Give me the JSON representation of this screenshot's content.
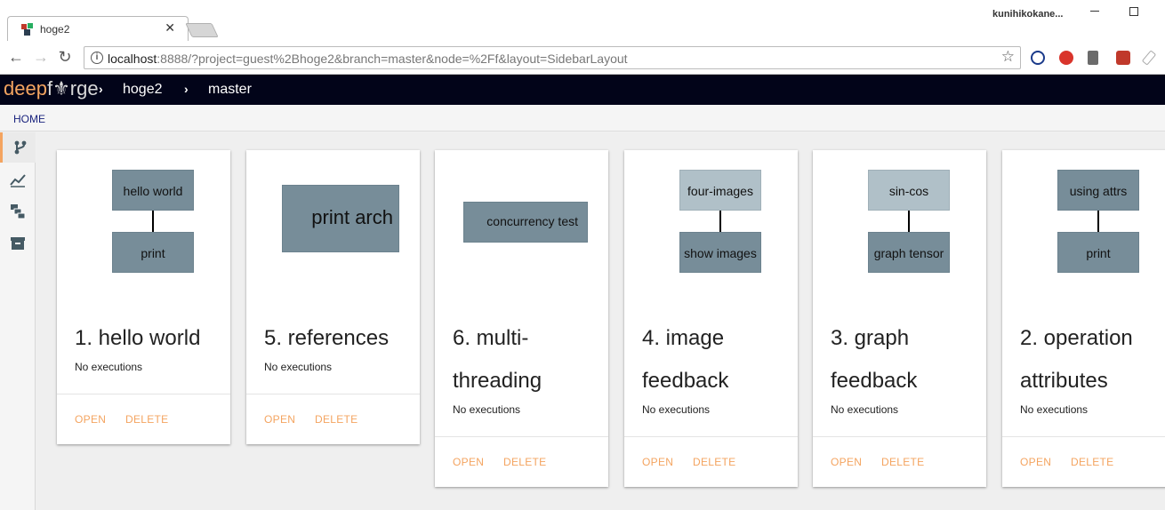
{
  "browser": {
    "tab_title": "hoge2",
    "tab_close": "✕",
    "user_name": "kunihikokane...",
    "url_host": "localhost",
    "url_rest": ":8888/?project=guest%2Bhoge2&branch=master&node=%2Ff&layout=SidebarLayout",
    "nav": {
      "back": "←",
      "forward": "→",
      "reload": "↻"
    },
    "star": "☆",
    "info": "i"
  },
  "app": {
    "logo_deep": "deep",
    "logo_forge": "f⚜rge",
    "breadcrumbs": [
      "hoge2",
      "master"
    ],
    "crumb_sep": "›",
    "home_label": "HOME"
  },
  "rail": {
    "icons": [
      "branch-icon",
      "chart-line-icon",
      "layers-icon",
      "archive-icon"
    ]
  },
  "colors": {
    "accent": "#f4a460",
    "header_bg": "#020419",
    "node": "#778d99",
    "node_light": "#b0c0c8"
  },
  "cards": [
    {
      "title": "1. hello world",
      "status": "No executions",
      "open": "OPEN",
      "delete": "DELETE",
      "nodes": [
        "hello world",
        "print"
      ]
    },
    {
      "title": "5. references",
      "status": "No executions",
      "open": "OPEN",
      "delete": "DELETE",
      "nodes": [
        "print arch"
      ]
    },
    {
      "title": "6. multi-threading",
      "status": "No executions",
      "open": "OPEN",
      "delete": "DELETE",
      "nodes": [
        "concurrency test"
      ]
    },
    {
      "title": "4. image feedback",
      "status": "No executions",
      "open": "OPEN",
      "delete": "DELETE",
      "nodes": [
        "four-images",
        "show images"
      ]
    },
    {
      "title": "3. graph feedback",
      "status": "No executions",
      "open": "OPEN",
      "delete": "DELETE",
      "nodes": [
        "sin-cos",
        "graph tensor"
      ]
    },
    {
      "title": "2. operation attributes",
      "status": "No executions",
      "open": "OPEN",
      "delete": "DELETE",
      "nodes": [
        "using attrs",
        "print"
      ]
    }
  ]
}
